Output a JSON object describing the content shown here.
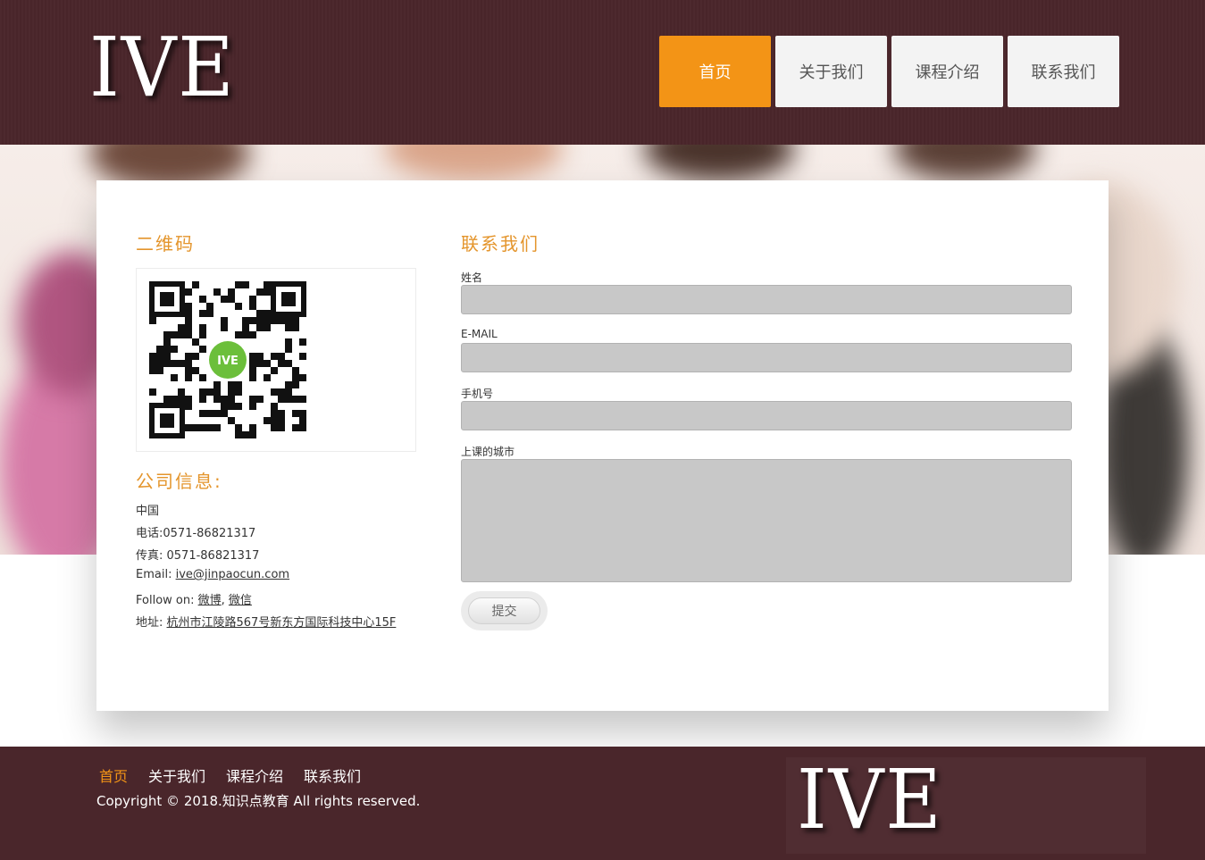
{
  "brand": {
    "logo_text": "IVE"
  },
  "nav": {
    "items": [
      "首页",
      "关于我们",
      "课程介绍",
      "联系我们"
    ],
    "active_index": 0
  },
  "qr_section": {
    "title": "二维码",
    "qr_logo_text": "IVE"
  },
  "company": {
    "title": "公司信息:",
    "country": "中国",
    "phone": "电话:0571-86821317",
    "fax": "传真: 0571-86821317",
    "email_label": "Email: ",
    "email": "ive@jinpaocun.com",
    "follow_label": "Follow on: ",
    "follow_weibo": "微博",
    "follow_sep": ", ",
    "follow_wechat": "微信",
    "address_label": "地址: ",
    "address": "杭州市江陵路567号新东方国际科技中心15F"
  },
  "contact_form": {
    "title": "联系我们",
    "name_label": "姓名",
    "name_value": "",
    "email_label": "E-MAIL",
    "email_value": "",
    "phone_label": "手机号",
    "phone_value": "",
    "city_label": "上课的城市",
    "city_value": "",
    "submit_label": "提交"
  },
  "footer": {
    "nav": [
      "首页",
      "关于我们",
      "课程介绍",
      "联系我们"
    ],
    "active_index": 0,
    "copyright": "Copyright © 2018.知识点教育 All rights reserved.",
    "logo_text": "IVE"
  },
  "colors": {
    "header_bg": "#4a262b",
    "accent": "#f39416",
    "title_orange": "#e4952c",
    "input_bg": "#c8c8c8"
  }
}
